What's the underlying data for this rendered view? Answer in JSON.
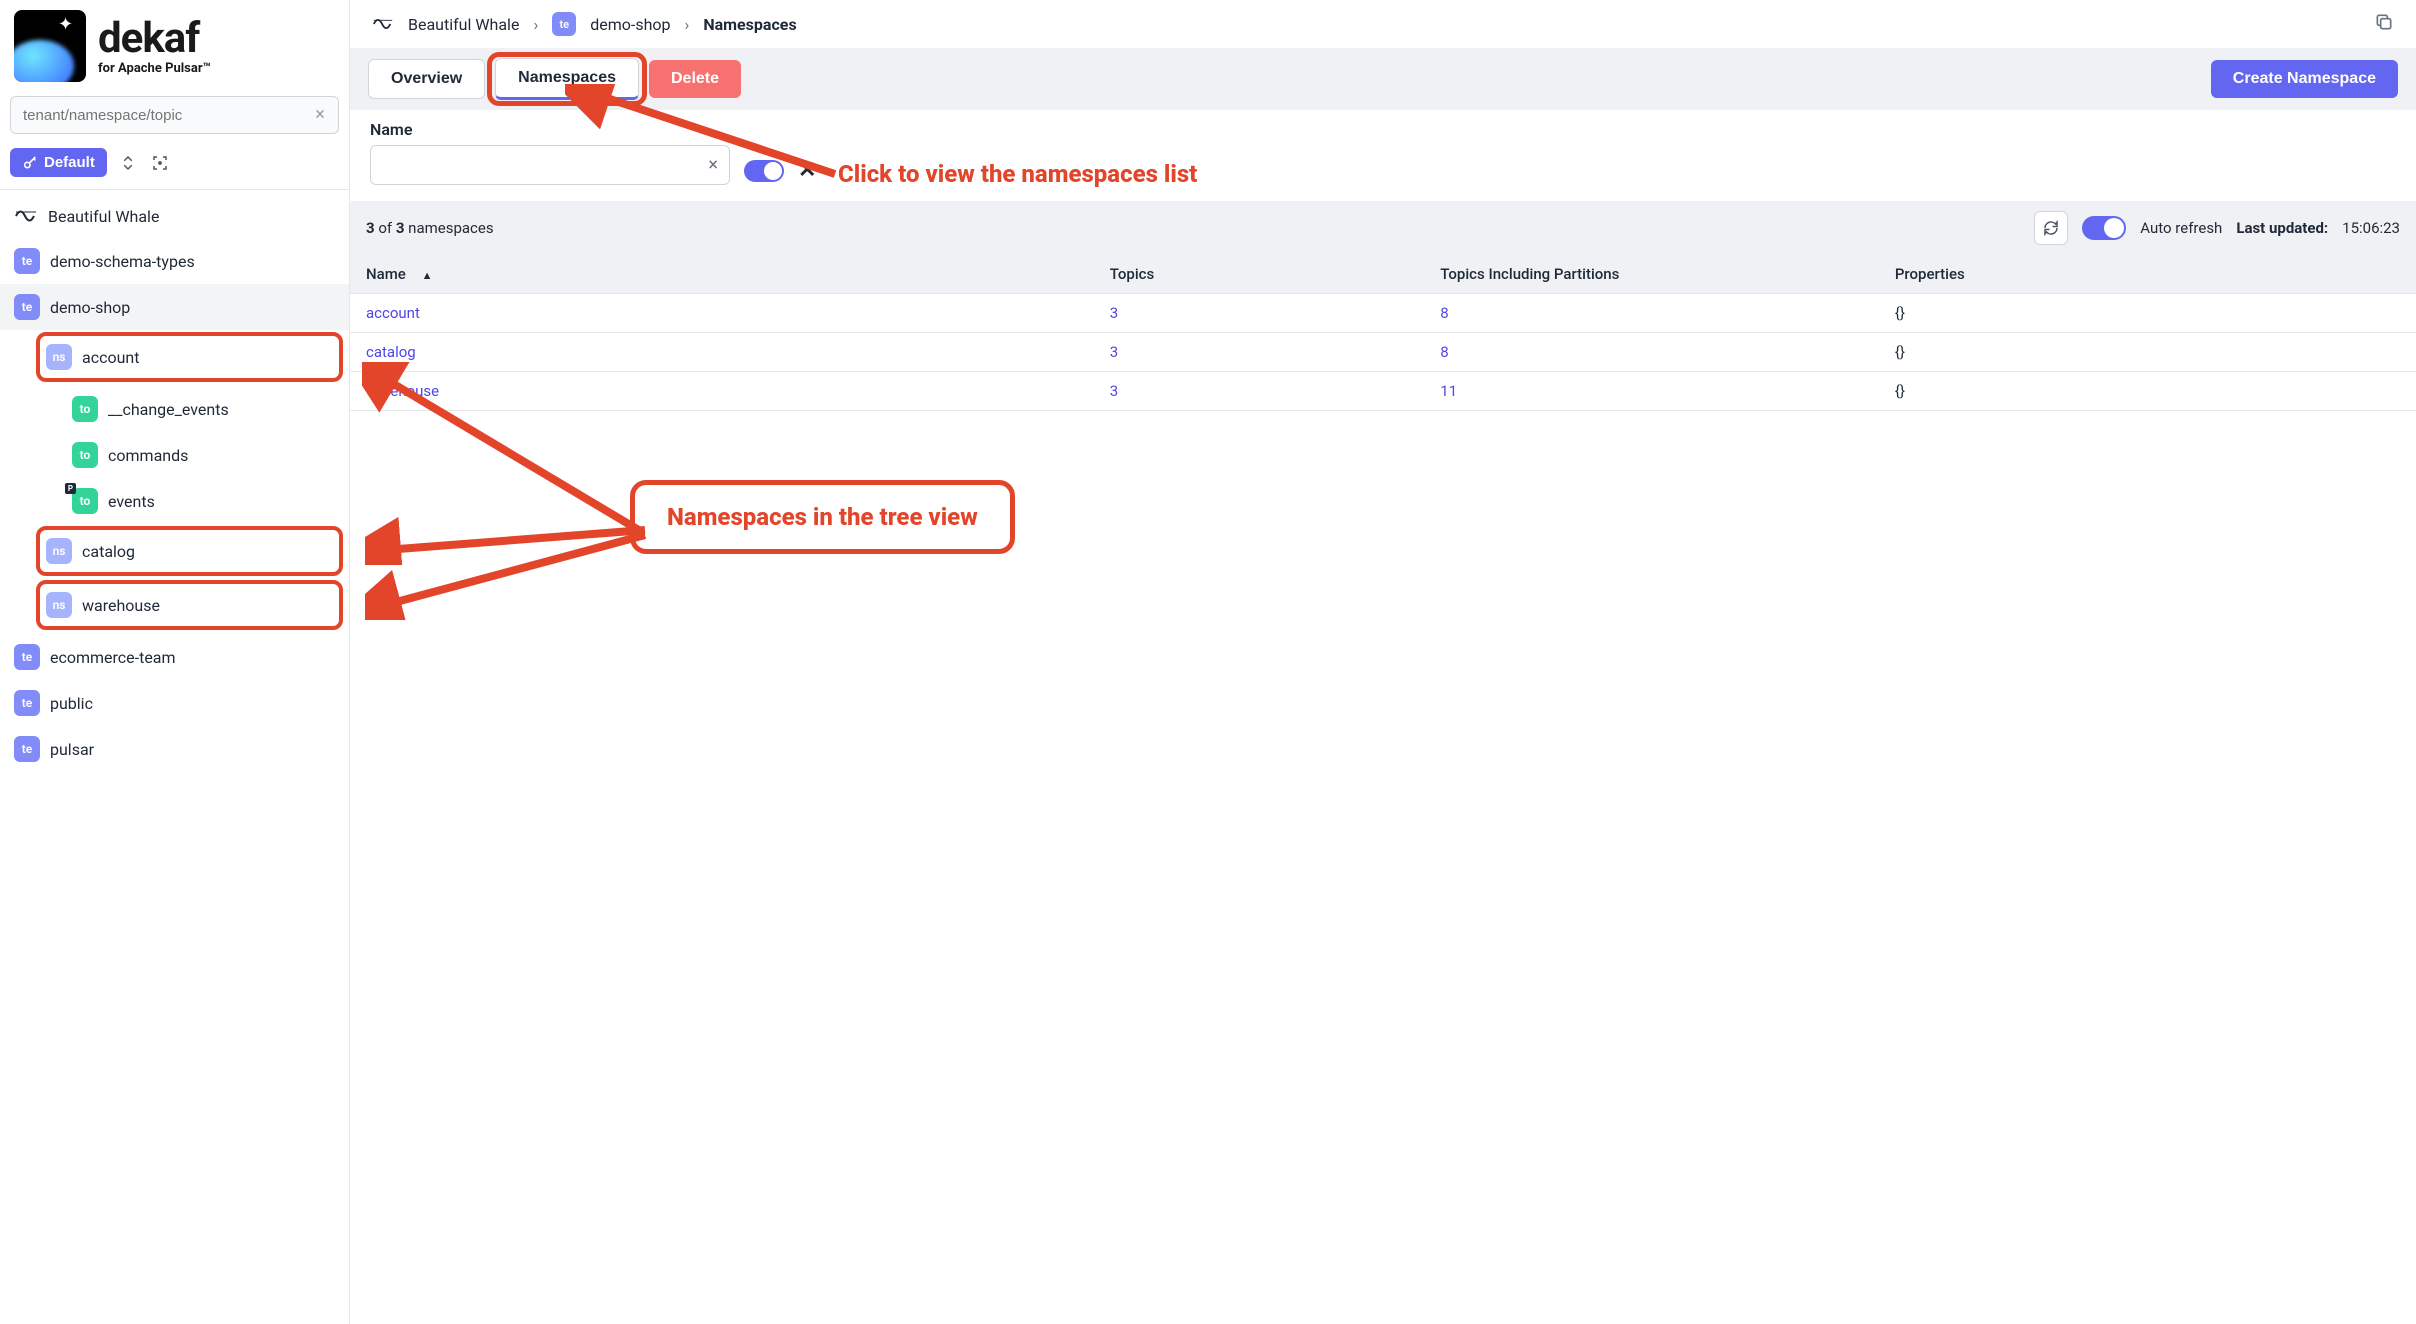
{
  "brand": {
    "name": "dekaf",
    "tagline": "for Apache Pulsar™"
  },
  "sidebar": {
    "search_placeholder": "tenant/namespace/topic",
    "default_btn": "Default",
    "cluster": "Beautiful Whale",
    "tree": {
      "tenants": [
        {
          "label": "demo-schema-types"
        },
        {
          "label": "demo-shop",
          "selected": true,
          "namespaces": [
            {
              "label": "account",
              "topics": [
                {
                  "label": "__change_events"
                },
                {
                  "label": "commands"
                },
                {
                  "label": "events",
                  "partitioned": true
                }
              ]
            },
            {
              "label": "catalog"
            },
            {
              "label": "warehouse"
            }
          ]
        },
        {
          "label": "ecommerce-team"
        },
        {
          "label": "public"
        },
        {
          "label": "pulsar"
        }
      ]
    }
  },
  "breadcrumb": {
    "cluster": "Beautiful Whale",
    "tenant_badge": "te",
    "tenant": "demo-shop",
    "current": "Namespaces"
  },
  "tabs": {
    "overview": "Overview",
    "namespaces": "Namespaces",
    "delete": "Delete",
    "create": "Create Namespace"
  },
  "filter": {
    "label": "Name"
  },
  "list": {
    "count_shown": "3",
    "count_total": "3",
    "count_noun": "namespaces",
    "auto_refresh": "Auto refresh",
    "last_updated_label": "Last updated:",
    "last_updated_value": "15:06:23",
    "columns": {
      "name": "Name",
      "topics": "Topics",
      "tip": "Topics Including Partitions",
      "properties": "Properties"
    },
    "rows": [
      {
        "name": "account",
        "topics": "3",
        "tip": "8",
        "properties": "{}"
      },
      {
        "name": "catalog",
        "topics": "3",
        "tip": "8",
        "properties": "{}"
      },
      {
        "name": "warehouse",
        "topics": "3",
        "tip": "11",
        "properties": "{}"
      }
    ]
  },
  "annotations": {
    "callout_tabs": "Click to view the namespaces list",
    "callout_tree": "Namespaces in the tree view"
  },
  "colors": {
    "accent": "#6366f1",
    "danger": "#f87171",
    "highlight": "#e3452b"
  },
  "badges": {
    "te": "te",
    "ns": "ns",
    "to": "to"
  }
}
